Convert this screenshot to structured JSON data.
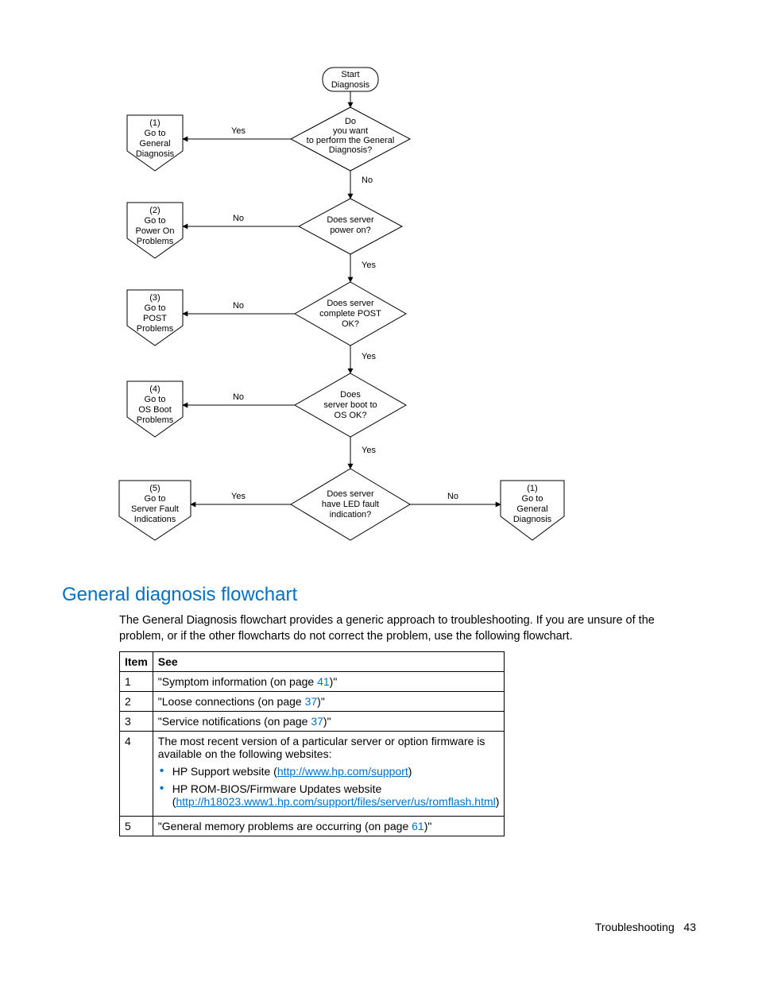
{
  "heading": "General diagnosis flowchart",
  "intro": "The General Diagnosis flowchart provides a generic approach to troubleshooting. If you are unsure of the problem, or if the other flowcharts do not correct the problem, use the following flowchart.",
  "table": {
    "headers": {
      "item": "Item",
      "see": "See"
    },
    "rows": [
      {
        "item": "1",
        "see_pre": "\"Symptom information (on page ",
        "see_page": "41",
        "see_post": ")\""
      },
      {
        "item": "2",
        "see_pre": "\"Loose connections (on page ",
        "see_page": "37",
        "see_post": ")\""
      },
      {
        "item": "3",
        "see_pre": "\"Service notifications (on page ",
        "see_page": "37",
        "see_post": ")\""
      },
      {
        "item": "4",
        "see_text": "The most recent version of a particular server or option firmware is available on the following websites:",
        "bullets": [
          {
            "pre": "HP Support website (",
            "link": "http://www.hp.com/support",
            "post": ")"
          },
          {
            "pre": "HP ROM-BIOS/Firmware Updates website (",
            "link": "http://h18023.www1.hp.com/support/files/server/us/romflash.html",
            "post": ")"
          }
        ]
      },
      {
        "item": "5",
        "see_pre": "\"General memory problems are occurring (on page ",
        "see_page": "61",
        "see_post": ")\""
      }
    ]
  },
  "footer": {
    "section": "Troubleshooting",
    "page": "43"
  },
  "flowchart": {
    "start": {
      "l1": "Start",
      "l2": "Diagnosis"
    },
    "d1": {
      "l1": "Do",
      "l2": "you want",
      "l3": "to perform the General",
      "l4": "Diagnosis?"
    },
    "d2": {
      "l1": "Does server",
      "l2": "power on?"
    },
    "d3": {
      "l1": "Does server",
      "l2": "complete POST",
      "l3": "OK?"
    },
    "d4": {
      "l1": "Does",
      "l2": "server boot to",
      "l3": "OS OK?"
    },
    "d5": {
      "l1": "Does server",
      "l2": "have LED fault",
      "l3": "indication?"
    },
    "o1": {
      "n": "(1)",
      "l1": "Go to",
      "l2": "General",
      "l3": "Diagnosis"
    },
    "o2": {
      "n": "(2)",
      "l1": "Go to",
      "l2": "Power On",
      "l3": "Problems"
    },
    "o3": {
      "n": "(3)",
      "l1": "Go to",
      "l2": "POST",
      "l3": "Problems"
    },
    "o4": {
      "n": "(4)",
      "l1": "Go to",
      "l2": "OS Boot",
      "l3": "Problems"
    },
    "o5": {
      "n": "(5)",
      "l1": "Go to",
      "l2": "Server Fault",
      "l3": "Indications"
    },
    "o6": {
      "n": "(1)",
      "l1": "Go to",
      "l2": "General",
      "l3": "Diagnosis"
    },
    "labels": {
      "yes": "Yes",
      "no": "No"
    }
  }
}
